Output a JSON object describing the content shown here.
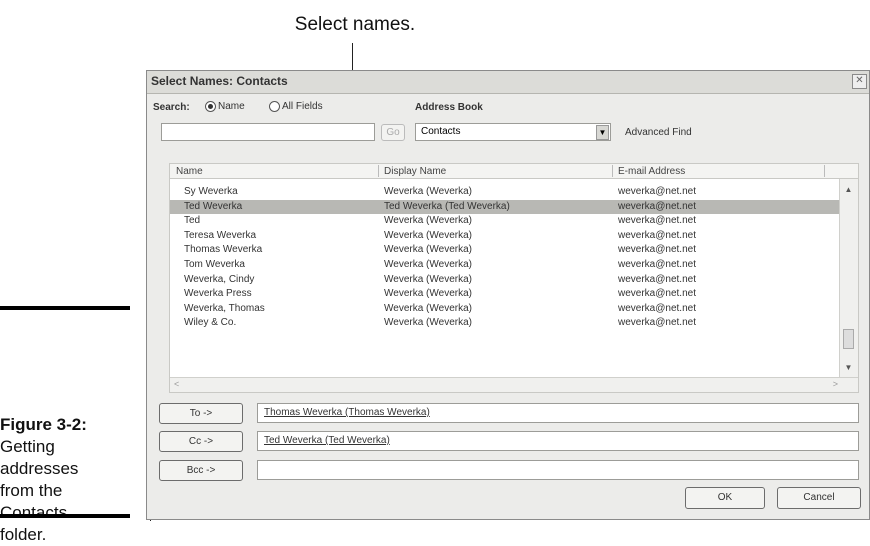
{
  "callout": "Select names.",
  "caption": {
    "figure": "Figure 3-2:",
    "lines": [
      "Getting",
      "addresses",
      "from the",
      "Contacts",
      "folder."
    ]
  },
  "dialog": {
    "title": "Select Names: Contacts",
    "close_icon": "close-x-icon",
    "search_label": "Search:",
    "radio_name": "Name",
    "radio_all_fields": "All Fields",
    "search_value": "",
    "go_label": "Go",
    "address_book_label": "Address Book",
    "address_book_value": "Contacts",
    "advanced_find": "Advanced Find",
    "columns": [
      "Name",
      "Display Name",
      "E-mail Address"
    ],
    "rows": [
      {
        "name": "Sy Weverka",
        "display": "Weverka (Weverka)",
        "email": "weverka@net.net"
      },
      {
        "name": "Ted Weverka",
        "display": "Ted Weverka (Ted Weverka)",
        "email": "weverka@net.net",
        "selected": true
      },
      {
        "name": "Ted",
        "display": "Weverka (Weverka)",
        "email": "weverka@net.net"
      },
      {
        "name": "Teresa Weverka",
        "display": "Weverka (Weverka)",
        "email": "weverka@net.net"
      },
      {
        "name": "Thomas Weverka",
        "display": "Weverka (Weverka)",
        "email": "weverka@net.net"
      },
      {
        "name": "Tom Weverka",
        "display": "Weverka (Weverka)",
        "email": "weverka@net.net"
      },
      {
        "name": "Weverka, Cindy",
        "display": "Weverka (Weverka)",
        "email": "weverka@net.net"
      },
      {
        "name": "Weverka Press",
        "display": "Weverka (Weverka)",
        "email": "weverka@net.net"
      },
      {
        "name": "Weverka, Thomas",
        "display": "Weverka (Weverka)",
        "email": "weverka@net.net"
      },
      {
        "name": "Wiley & Co.",
        "display": "Weverka (Weverka)",
        "email": "weverka@net.net"
      }
    ],
    "to_button": "To ->",
    "cc_button": "Cc ->",
    "bcc_button": "Bcc ->",
    "to_value": "Thomas Weverka (Thomas Weverka)",
    "cc_value": "Ted Weverka (Ted Weverka)",
    "bcc_value": "",
    "ok_button": "OK",
    "cancel_button": "Cancel"
  }
}
